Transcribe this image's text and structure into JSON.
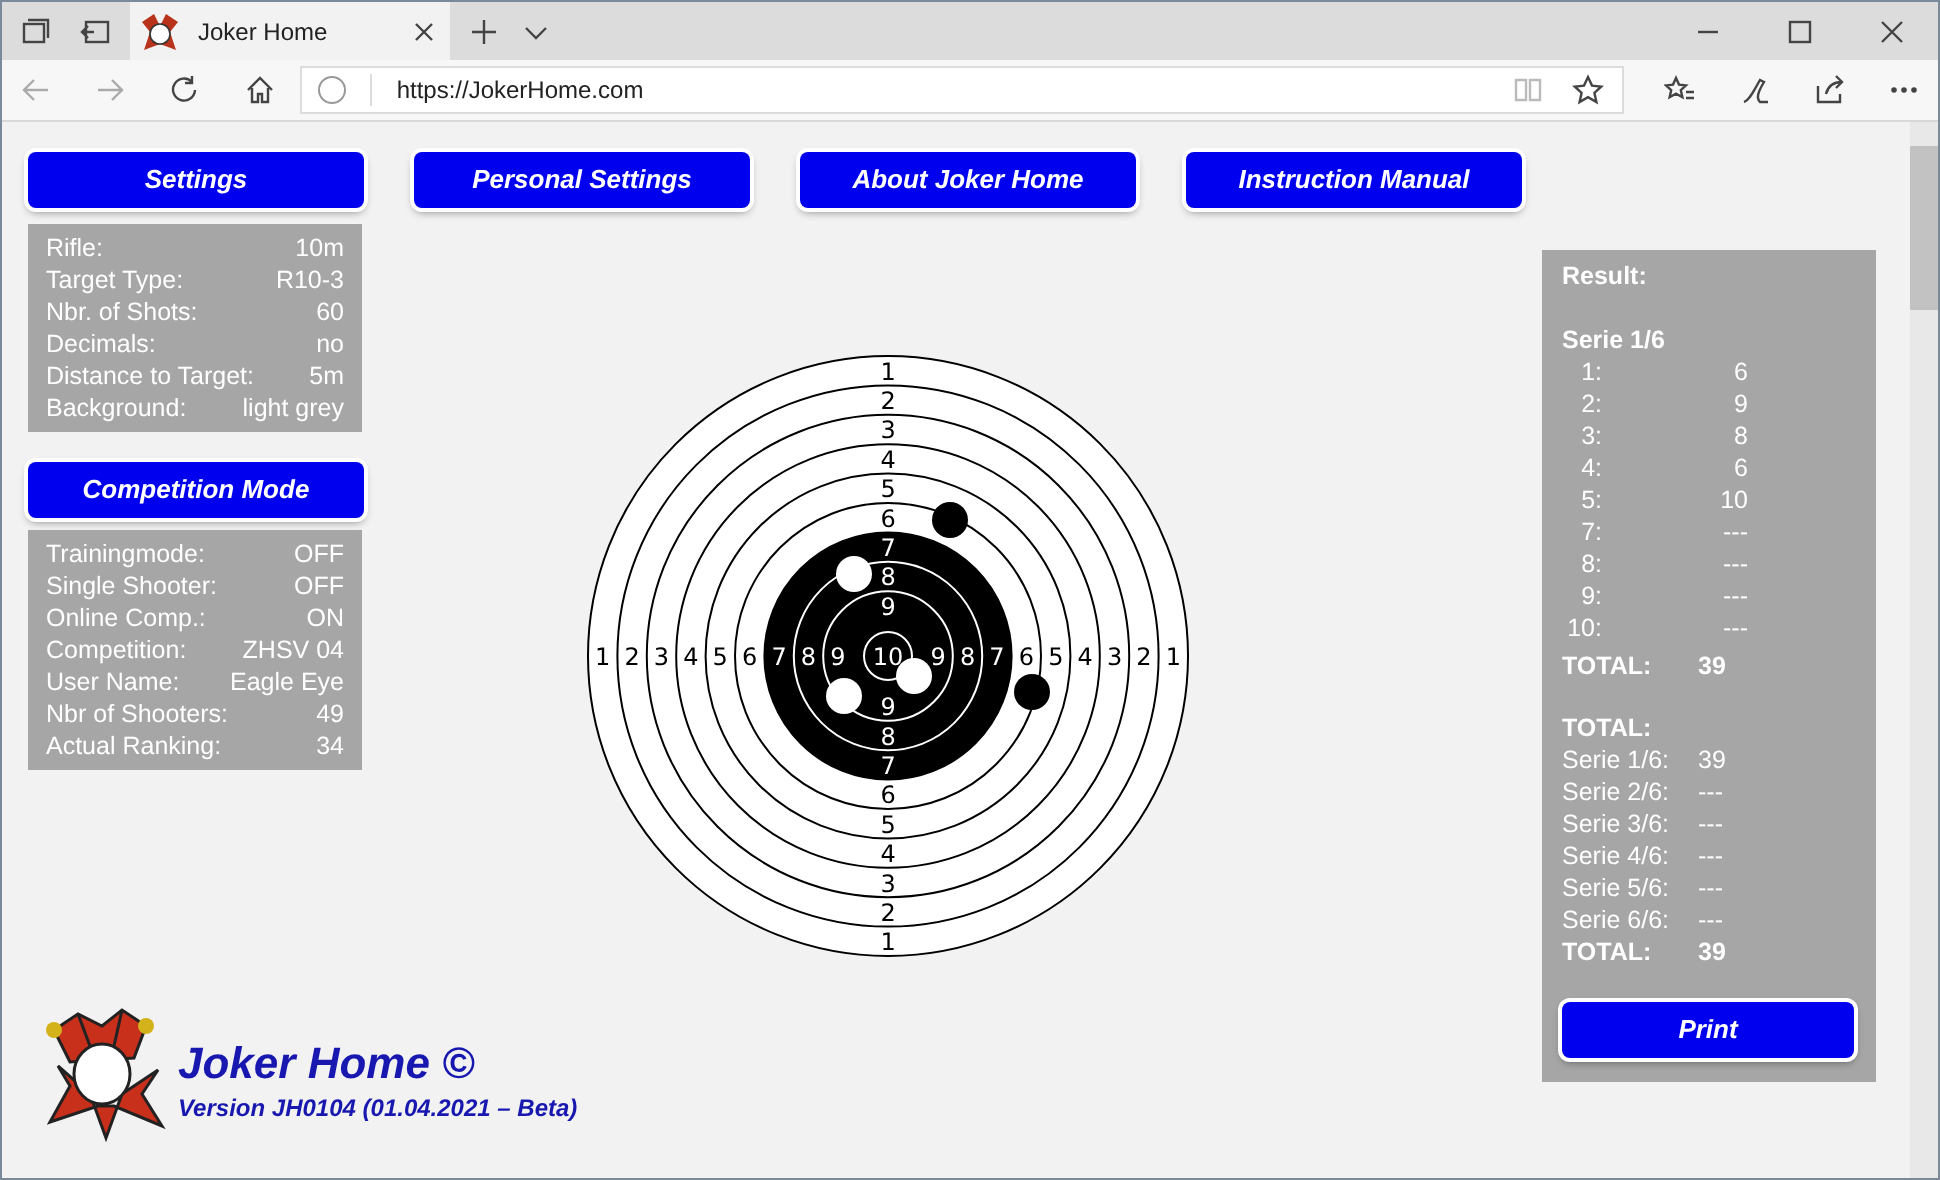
{
  "browser": {
    "tab_title": "Joker Home",
    "url": "https://JokerHome.com"
  },
  "nav_buttons": [
    "Settings",
    "Personal Settings",
    "About Joker Home",
    "Instruction Manual"
  ],
  "settings": [
    {
      "label": "Rifle:",
      "value": "10m"
    },
    {
      "label": "Target Type:",
      "value": "R10-3"
    },
    {
      "label": "Nbr. of Shots:",
      "value": "60"
    },
    {
      "label": "Decimals:",
      "value": "no"
    },
    {
      "label": "Distance to Target:",
      "value": "5m"
    },
    {
      "label": "Background:",
      "value": "light grey"
    }
  ],
  "competition_button": "Competition Mode",
  "competition": [
    {
      "label": "Trainingmode:",
      "value": "OFF"
    },
    {
      "label": "Single Shooter:",
      "value": "OFF"
    },
    {
      "label": "Online Comp.:",
      "value": "ON"
    },
    {
      "label": "Competition:",
      "value": "ZHSV 04"
    },
    {
      "label": "User Name:",
      "value": "Eagle Eye"
    },
    {
      "label": "Nbr of Shooters:",
      "value": "49"
    },
    {
      "label": "Actual Ranking:",
      "value": "34"
    }
  ],
  "target": {
    "rings": [
      {
        "labels": [
          "1",
          "1",
          "1",
          "1"
        ]
      },
      {
        "labels": [
          "2",
          "2",
          "2",
          "2"
        ]
      },
      {
        "labels": [
          "3",
          "3",
          "3",
          "3"
        ]
      },
      {
        "labels": [
          "4",
          "4",
          "4",
          "4"
        ]
      },
      {
        "labels": [
          "5",
          "5",
          "5",
          "5"
        ]
      },
      {
        "labels": [
          "6",
          "6",
          "6",
          "6"
        ]
      },
      {
        "labels": [
          "7",
          "7",
          "7",
          "7"
        ]
      },
      {
        "labels": [
          "8",
          "8",
          "8",
          "8"
        ]
      },
      {
        "labels": [
          "9",
          "9",
          "9",
          "9"
        ]
      },
      {
        "labels": [
          "10"
        ]
      }
    ]
  },
  "result": {
    "title": "Result:",
    "series_title": "Serie 1/6",
    "shots": [
      {
        "label": "1:",
        "value": "6"
      },
      {
        "label": "2:",
        "value": "9"
      },
      {
        "label": "3:",
        "value": "8"
      },
      {
        "label": "4:",
        "value": "6"
      },
      {
        "label": "5:",
        "value": "10"
      },
      {
        "label": "7:",
        "value": "---"
      },
      {
        "label": "8:",
        "value": "---"
      },
      {
        "label": "9:",
        "value": "---"
      },
      {
        "label": "10:",
        "value": "---"
      }
    ],
    "series_total": {
      "label": "TOTAL:",
      "value": "39"
    },
    "overall_title": "TOTAL:",
    "series": [
      {
        "label": "Serie 1/6:",
        "value": "39"
      },
      {
        "label": "Serie 2/6:",
        "value": "---"
      },
      {
        "label": "Serie 3/6:",
        "value": "---"
      },
      {
        "label": "Serie 4/6:",
        "value": "---"
      },
      {
        "label": "Serie 5/6:",
        "value": "---"
      },
      {
        "label": "Serie 6/6:",
        "value": "---"
      }
    ],
    "overall_total": {
      "label": "TOTAL:",
      "value": "39"
    },
    "print_button": "Print"
  },
  "footer": {
    "title": "Joker Home ©",
    "version": "Version JH0104 (01.04.2021 – Beta)"
  }
}
